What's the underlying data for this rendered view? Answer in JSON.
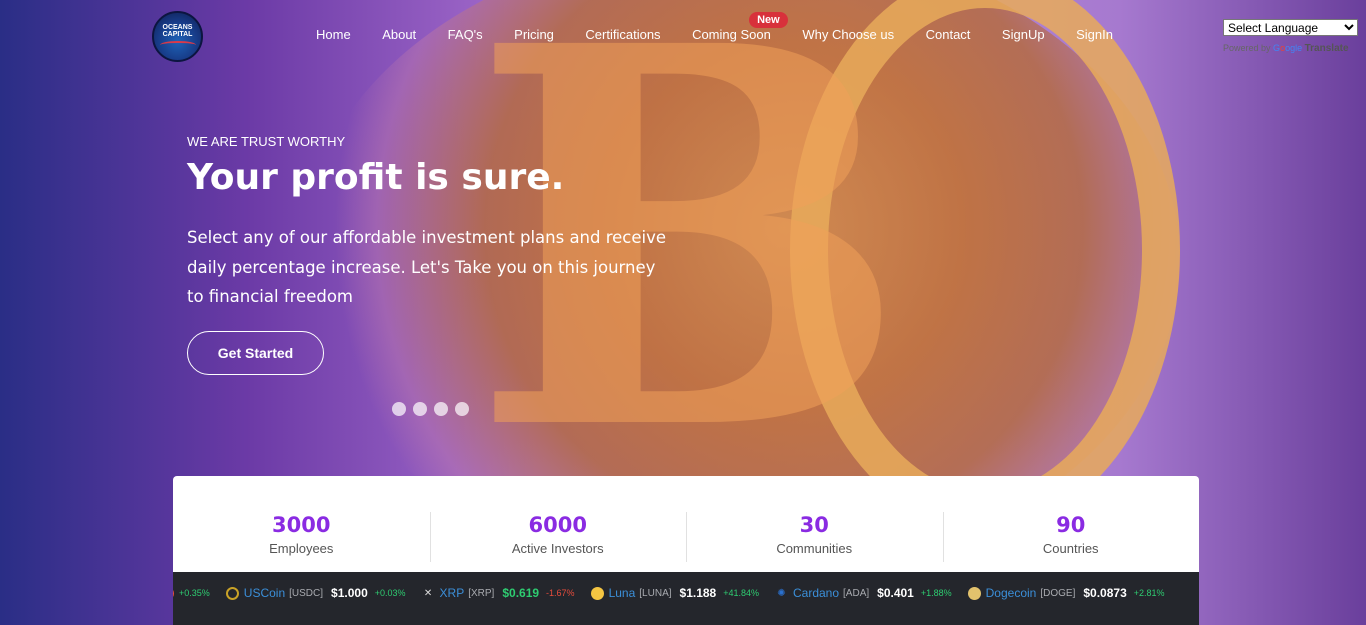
{
  "brand": {
    "logo_line1": "OCEANS",
    "logo_line2": "CAPITAL"
  },
  "nav": {
    "items": [
      "Home",
      "About",
      "FAQ's",
      "Pricing",
      "Certifications",
      "Coming Soon",
      "Why Choose us",
      "Contact",
      "SignUp",
      "SignIn"
    ],
    "badge": "New"
  },
  "translate": {
    "select_label": "Select Language",
    "powered_by": "Powered by",
    "translate": "Translate"
  },
  "hero": {
    "eyebrow": "WE ARE TRUST WORTHY",
    "headline": "Your profit is sure.",
    "lead": "Select any of our affordable investment plans and receive daily percentage increase. Let's Take you on this journey to financial freedom",
    "cta": "Get Started",
    "slide_count": 4
  },
  "stats": [
    {
      "value": "3000",
      "label": "Employees"
    },
    {
      "value": "6000",
      "label": "Active Investors"
    },
    {
      "value": "30",
      "label": "Communities"
    },
    {
      "value": "90",
      "label": "Countries"
    }
  ],
  "ticker": [
    {
      "name": "",
      "symbol": "",
      "price": "",
      "change": "+0.35%",
      "dir": "up",
      "icon": "coin-icon",
      "color": "#e74c3c"
    },
    {
      "name": "USCoin",
      "symbol": "[USDC]",
      "price": "$1.000",
      "change": "+0.03%",
      "dir": "up",
      "icon": "usdc-icon",
      "color": "#c9a227"
    },
    {
      "name": "XRP",
      "symbol": "[XRP]",
      "price": "$0.619",
      "change": "-1.67%",
      "dir": "down",
      "icon": "xrp-icon",
      "color": "#dddddd",
      "price_color": "#2ecc71"
    },
    {
      "name": "Luna",
      "symbol": "[LUNA]",
      "price": "$1.188",
      "change": "+41.84%",
      "dir": "up",
      "icon": "luna-icon",
      "color": "#f4c542"
    },
    {
      "name": "Cardano",
      "symbol": "[ADA]",
      "price": "$0.401",
      "change": "+1.88%",
      "dir": "up",
      "icon": "cardano-icon",
      "color": "#2a71d0"
    },
    {
      "name": "Dogecoin",
      "symbol": "[DOGE]",
      "price": "$0.0873",
      "change": "+2.81%",
      "dir": "up",
      "icon": "dogecoin-icon",
      "color": "#e2c26d"
    }
  ]
}
